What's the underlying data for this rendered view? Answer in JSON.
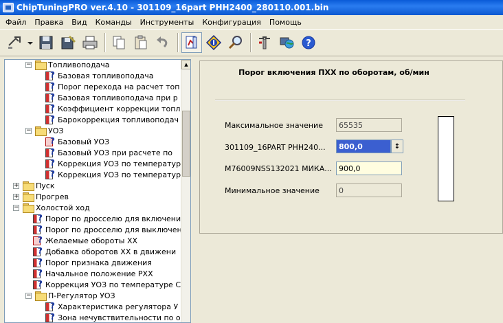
{
  "window": {
    "title": "ChipTuningPRO ver.4.10 - 301109_16part PHH2400_280110.001.bin"
  },
  "menu": [
    "Файл",
    "Правка",
    "Вид",
    "Команды",
    "Инструменты",
    "Конфигурация",
    "Помощь"
  ],
  "toolbar": {
    "icons": [
      "open-icon",
      "dropdown-arrow-icon",
      "save-icon",
      "save-as-icon",
      "print-icon",
      "copy-icon",
      "paste-icon",
      "undo-icon",
      "table-view-icon",
      "info-icon",
      "search-icon",
      "tools-icon",
      "globe-icon",
      "help-icon"
    ]
  },
  "tree": {
    "nodes": [
      {
        "label": "Топливоподача",
        "level": 2,
        "kind": "folder",
        "expanded": true
      },
      {
        "label": "Базовая топливоподача",
        "level": 3,
        "kind": "table",
        "variant": "mixed"
      },
      {
        "label": "Порог перехода на расчет топ",
        "level": 3,
        "kind": "table",
        "variant": "mixed"
      },
      {
        "label": "Базовая топливоподача при р",
        "level": 3,
        "kind": "table",
        "variant": "mixed"
      },
      {
        "label": "Коэффициент коррекции топл",
        "level": 3,
        "kind": "table",
        "variant": "mixed"
      },
      {
        "label": "Барокоррекция топливоподач",
        "level": 3,
        "kind": "table",
        "variant": "mixed"
      },
      {
        "label": "УОЗ",
        "level": 2,
        "kind": "folder",
        "expanded": true
      },
      {
        "label": "Базовый УОЗ",
        "level": 3,
        "kind": "table",
        "variant": "red"
      },
      {
        "label": "Базовый УОЗ при расчете по",
        "level": 3,
        "kind": "table",
        "variant": "mixed"
      },
      {
        "label": "Коррекция УОЗ по температур",
        "level": 3,
        "kind": "table",
        "variant": "mixed"
      },
      {
        "label": "Коррекция УОЗ по температур",
        "level": 3,
        "kind": "table",
        "variant": "mixed"
      },
      {
        "label": "Пуск",
        "level": 1,
        "kind": "folder",
        "expanded": false
      },
      {
        "label": "Прогрев",
        "level": 1,
        "kind": "folder",
        "expanded": false
      },
      {
        "label": "Холостой ход",
        "level": 1,
        "kind": "folder",
        "expanded": true
      },
      {
        "label": "Порог по дросселю для включени",
        "level": 2,
        "kind": "table",
        "variant": "mixed"
      },
      {
        "label": "Порог по дросселю для выключен",
        "level": 2,
        "kind": "table",
        "variant": "mixed"
      },
      {
        "label": "Желаемые обороты ХХ",
        "level": 2,
        "kind": "table",
        "variant": "red"
      },
      {
        "label": "Добавка оборотов ХХ в движени",
        "level": 2,
        "kind": "table",
        "variant": "mixed"
      },
      {
        "label": "Порог признака движения",
        "level": 2,
        "kind": "table",
        "variant": "mixed"
      },
      {
        "label": "Начальное положение РХХ",
        "level": 2,
        "kind": "table",
        "variant": "mixed"
      },
      {
        "label": "Коррекция УОЗ по температуре С",
        "level": 2,
        "kind": "table",
        "variant": "mixed"
      },
      {
        "label": "П-Регулятор УОЗ",
        "level": 2,
        "kind": "folder",
        "expanded": true
      },
      {
        "label": "Характеристика регулятора У",
        "level": 3,
        "kind": "table",
        "variant": "mixed"
      },
      {
        "label": "Зона нечувствительности по о",
        "level": 3,
        "kind": "table",
        "variant": "mixed"
      }
    ]
  },
  "param": {
    "title": "Порог включения ПХХ по оборотам, об/мин",
    "max_label": "Максимальное значение",
    "max_value": "65535",
    "file1_label": "301109_16PART PHH240...",
    "file1_value": "800,0",
    "file2_label": "M76009NSS132021 МИКА...",
    "file2_value": "900,0",
    "min_label": "Минимальное значение",
    "min_value": "0",
    "level_fraction": 0.0
  }
}
